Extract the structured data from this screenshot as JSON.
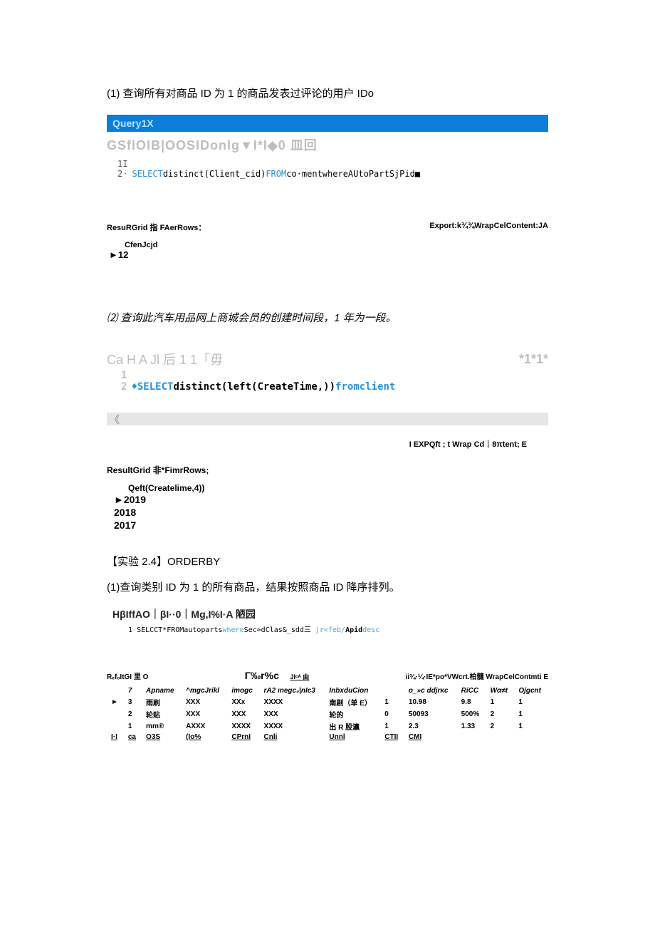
{
  "q1": {
    "prompt": "(1)  查询所有对商品 ID 为 1 的商品发表过评论的用户 IDo",
    "tab": "Query1X",
    "editor_header": "GSflOIB|OOSIDonlg▼I*I◆0 皿回",
    "code": {
      "l1_num": "1I",
      "l2": "2·SELECTdistinct(Client_cid)FROMco·mentwhereAUtoPartSjPid■",
      "l2_kw1": "SELECT",
      "l2_mid": "distinct(Client_cid)",
      "l2_kw2": "FROM",
      "l2_tail": "co·mentwhereAUtoPartSjPid■"
    },
    "result": {
      "left": "ResuRGrid 指 FAerRows：",
      "right": "Export:k¾¾WrapCelContent:JA",
      "col": "CfenJcjd",
      "row": "►12"
    }
  },
  "q2": {
    "prompt": "⑵ 查询此汽车用品网上商城会员的创建时间段，1 年为一段。",
    "header_left": "Ca H A Jl 后  1 1「毋",
    "header_right": "*1*1*",
    "code": {
      "l1_num": "1",
      "l2_num": "2",
      "l2_diamond": "♦",
      "l2_kw1": "SELECT",
      "l2_mid": "distinct(left(CreateTime,))",
      "l2_kw2": "from",
      "l2_tail": "client"
    },
    "graybar": "《",
    "export_line": "I EXPQft ;  t Wrap Cd｜8πtent; E",
    "result_head": "ResultGrid 非*FimrRows;",
    "col": "Qeft(Createlime,4))",
    "years": [
      "►2019",
      "  2018",
      "  2017"
    ]
  },
  "expt": {
    "title": "【实验 2.4】ORDERBY"
  },
  "q3": {
    "prompt": "(1)查询类别 ID 为 1 的所有商品，结果按照商品 ID 降序排列。",
    "header": "HβIffAO｜βI··0｜Mg,I%I·A 陋园",
    "sql_num": "1",
    "sql": "·SELCCT*FROMautopartswhereSec≈dClas&_sdd三 jr<feb/Apiddesc",
    "meta_left": "RₑfₒItGI 里 O",
    "meta_mid": "Γ‰r%c",
    "meta_mid2": "JIᶜᴬ 由",
    "meta_right": "ii¾·¼·IE*po*VWcrt.柏髓 WrapCelContmti    E"
  },
  "table": {
    "headers": [
      "",
      "7",
      "Apname",
      "^mgcJrikl",
      "imogc",
      "rA2 ınegc₀|nIc3",
      "InbxduCion",
      "",
      "o_»c ddjrκc",
      "RiCC",
      "Wα≠t",
      "Ojgcnt"
    ],
    "rows": [
      [
        "►",
        "3",
        "雨刷",
        "XXX",
        "XXx",
        "XXXX",
        "南剧（单 E）",
        "1",
        "10.98",
        "9.8",
        "1",
        "1"
      ],
      [
        "",
        "2",
        "轮贴",
        "XXX",
        "XXX",
        "XXX",
        "轮的",
        "0",
        "50093",
        "500%",
        "2",
        "1"
      ],
      [
        "",
        "1",
        "mm®",
        "AXXX",
        "XXXX",
        "XXXX",
        "出 R 股瀛",
        "1",
        "2.3",
        "1.33",
        "2",
        "1"
      ]
    ],
    "footer": [
      "I·I",
      "ca",
      "O3S",
      "(Io%",
      "CPrnI",
      "Cnli",
      "Unnl",
      "CTII",
      "CMI",
      "",
      "",
      ""
    ]
  }
}
